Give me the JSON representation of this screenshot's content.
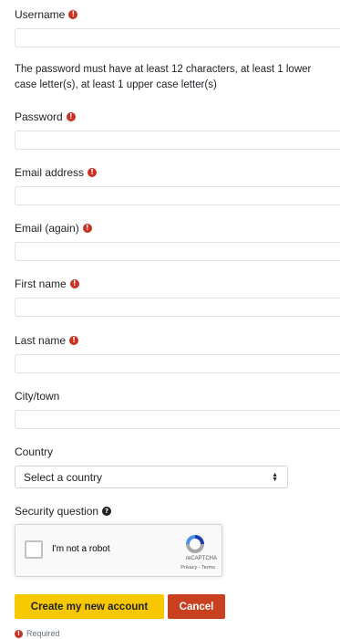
{
  "fields": {
    "username": {
      "label": "Username",
      "value": "",
      "placeholder": ""
    },
    "password_note": "The password must have at least 12 characters, at least 1 lower case letter(s), at least 1 upper case letter(s)",
    "password": {
      "label": "Password",
      "value": "",
      "placeholder": ""
    },
    "email": {
      "label": "Email address",
      "value": "",
      "placeholder": ""
    },
    "email_again": {
      "label": "Email (again)",
      "value": "",
      "placeholder": ""
    },
    "first_name": {
      "label": "First name",
      "value": "",
      "placeholder": ""
    },
    "last_name": {
      "label": "Last name",
      "value": "",
      "placeholder": ""
    },
    "city": {
      "label": "City/town",
      "value": "",
      "placeholder": ""
    },
    "country": {
      "label": "Country",
      "selected": "Select a country"
    },
    "security": {
      "label": "Security question"
    }
  },
  "icons": {
    "required": "exclamation-circle-icon",
    "required_glyph": "!",
    "help": "question-circle-icon",
    "help_glyph": "?",
    "select_arrows": "sort-arrows-icon",
    "arrow_up_glyph": "▲",
    "arrow_down_glyph": "▼"
  },
  "recaptcha": {
    "label": "I'm not a robot",
    "brand": "reCAPTCHA",
    "terms": "Privacy - Terms"
  },
  "buttons": {
    "submit": "Create my new account",
    "cancel": "Cancel"
  },
  "footer": {
    "required_text": "Required"
  },
  "colors": {
    "required": "#ca3120",
    "primary": "#f7c700",
    "cancel": "#c8401f",
    "border": "#dee2e6",
    "text": "#1d2125"
  }
}
